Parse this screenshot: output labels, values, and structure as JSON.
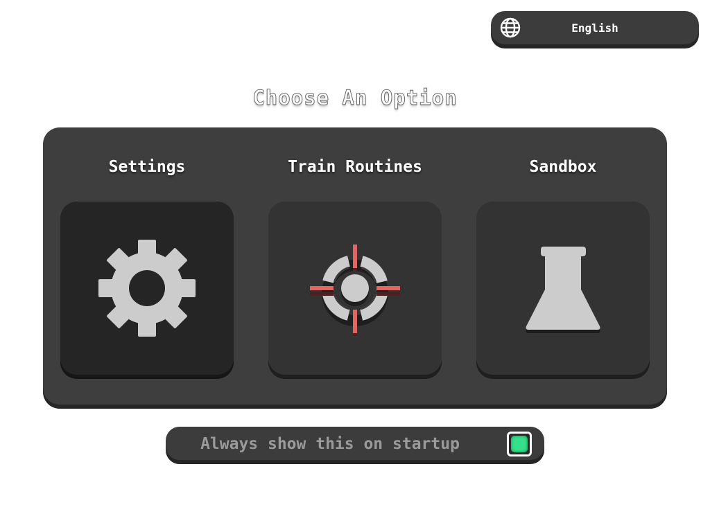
{
  "language": {
    "icon": "globe-icon",
    "selected": "English"
  },
  "heading": "Choose An Option",
  "options": [
    {
      "label": "Settings",
      "icon": "gear-icon",
      "active": true
    },
    {
      "label": "Train Routines",
      "icon": "crosshair-target-icon",
      "active": false
    },
    {
      "label": "Sandbox",
      "icon": "flask-icon",
      "active": false
    }
  ],
  "startup": {
    "label": "Always show this on startup",
    "checked": true
  },
  "colors": {
    "panel": "#3e3e3e",
    "tile": "#333333",
    "tile_active": "#252525",
    "icon": "#cccccc",
    "crosshair_accent": "#e06666",
    "checkbox_on": "#36e08a"
  }
}
